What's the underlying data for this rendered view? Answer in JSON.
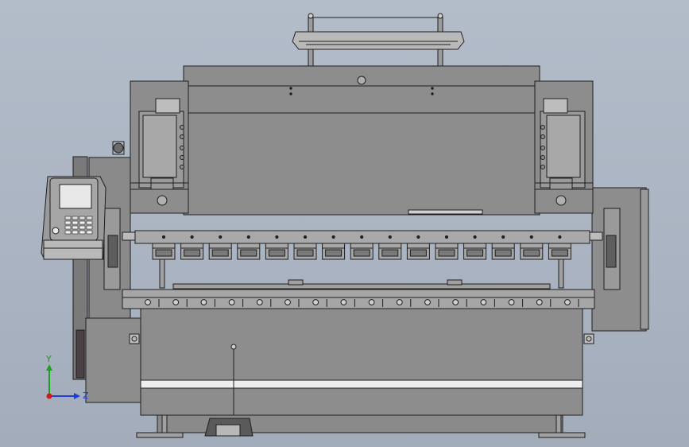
{
  "view": {
    "background_top": "#b3bcc9",
    "background_bottom": "#a3acba",
    "part_fill": "#8d8d8d",
    "part_fill_light": "#a4a4a4",
    "part_fill_dark": "#767676",
    "edge_color": "#1e1e1e",
    "screen_color": "#e8e8e8"
  },
  "model": {
    "name": "press brake",
    "punch_clamp_count": 15,
    "die_slot_count": 16,
    "cylinder_count": 2
  },
  "triad": {
    "y_label": "Y",
    "z_label": "Z",
    "y_color": "#1aa31a",
    "z_color": "#1f3fd6",
    "origin_color": "#d31a1a"
  }
}
